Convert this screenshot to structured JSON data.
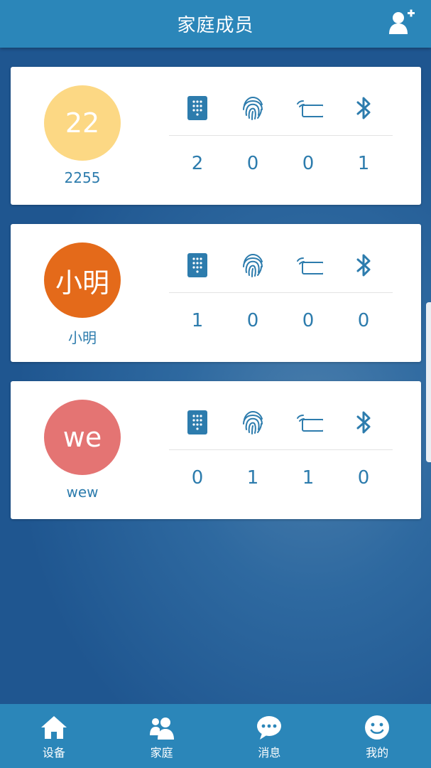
{
  "header": {
    "title": "家庭成员",
    "add_icon": "add-user-icon"
  },
  "colors": {
    "header_bg": "#2b86b9",
    "accent": "#2d7cad"
  },
  "members": [
    {
      "avatar_text": "22",
      "avatar_color": "#fcd884",
      "name": "2255",
      "counts": [
        "2",
        "0",
        "0",
        "1"
      ]
    },
    {
      "avatar_text": "小明",
      "avatar_color": "#e46a1a",
      "name": "小明",
      "counts": [
        "1",
        "0",
        "0",
        "0"
      ]
    },
    {
      "avatar_text": "we",
      "avatar_color": "#e47473",
      "name": "wew",
      "counts": [
        "0",
        "1",
        "1",
        "0"
      ]
    }
  ],
  "credential_icons": [
    "keypad-icon",
    "fingerprint-icon",
    "card-icon",
    "bluetooth-icon"
  ],
  "tabs": [
    {
      "label": "设备",
      "icon": "home-icon"
    },
    {
      "label": "家庭",
      "icon": "family-icon"
    },
    {
      "label": "消息",
      "icon": "chat-icon"
    },
    {
      "label": "我的",
      "icon": "smiley-icon"
    }
  ]
}
